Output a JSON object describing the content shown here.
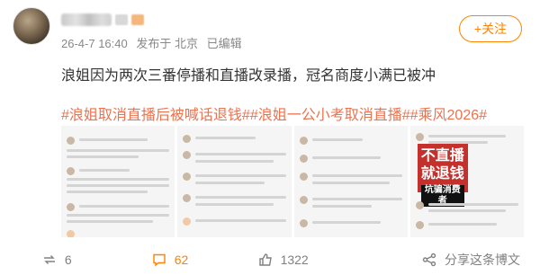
{
  "post": {
    "meta": {
      "time": "26-4-7 16:40",
      "source": "发布于 北京",
      "edited": "已编辑"
    },
    "follow_label": "+关注",
    "text": "浪姐因为两次三番停播和直播改录播，冠名商度小满已被冲",
    "tags": [
      "#浪姐取消直播后被喊话退钱#",
      "#浪姐一公小考取消直播#",
      "#乘风2026#"
    ],
    "image_poster_text": {
      "line1": "不直播",
      "line2": "就退钱",
      "line3": "坑骗消费者"
    }
  },
  "actions": {
    "repost_count": "6",
    "comment_count": "62",
    "like_count": "1322",
    "share_label": "分享这条博文"
  },
  "colors": {
    "accent": "#ff8200",
    "tag": "#eb7350",
    "comment_highlight": "#ff8200"
  }
}
